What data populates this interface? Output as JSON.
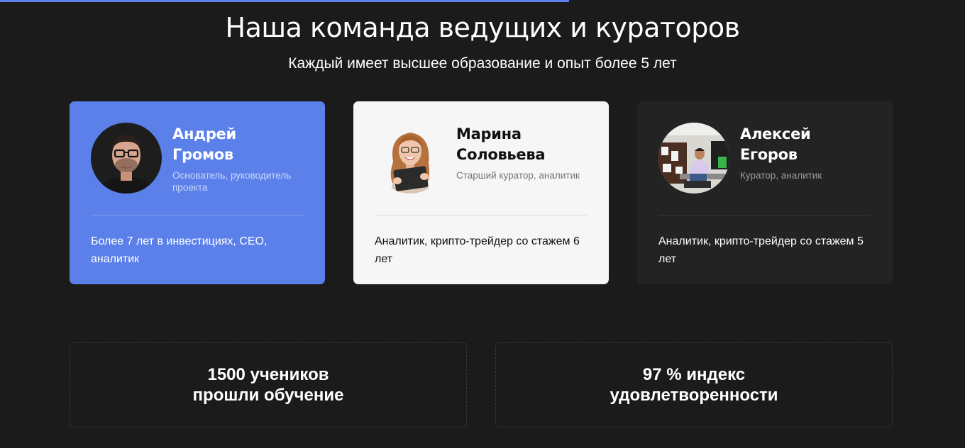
{
  "progress": {
    "fraction": 0.59,
    "color": "#5b80ea"
  },
  "header": {
    "title": "Наша команда ведущих и кураторов",
    "subtitle": "Каждый имеет высшее образование и опыт более 5 лет"
  },
  "team": [
    {
      "first_name": "Андрей",
      "last_name": "Громов",
      "role": "Основатель, руководитель проекта",
      "bio": "Более 7 лет в инвестициях, CEO, аналитик",
      "card_color": "#5b80ea"
    },
    {
      "first_name": "Марина",
      "last_name": "Соловьева",
      "role": "Старший куратор, аналитик",
      "bio": "Аналитик, крипто-трейдер со стажем 6 лет",
      "card_color": "#f6f6f6"
    },
    {
      "first_name": "Алексей",
      "last_name": "Егоров",
      "role": "Куратор, аналитик",
      "bio": "Аналитик, крипто-трейдер со стажем 5 лет",
      "card_color": "#232323"
    }
  ],
  "stats": [
    {
      "line1": "1500 учеников",
      "line2": "прошли обучение"
    },
    {
      "line1": "97 % индекс",
      "line2": "удовлетворенности"
    }
  ]
}
